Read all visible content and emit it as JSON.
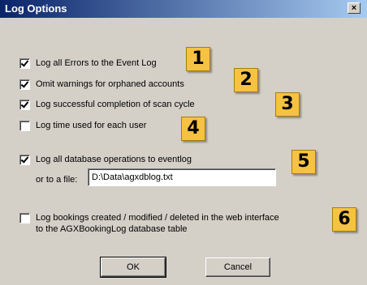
{
  "window": {
    "title": "Log Options",
    "close_label": "×"
  },
  "options": [
    {
      "label": "Log all Errors to the Event Log",
      "checked": true
    },
    {
      "label": "Omit warnings for orphaned accounts",
      "checked": true
    },
    {
      "label": "Log successful completion of scan cycle",
      "checked": true
    },
    {
      "label": "Log time used for each user",
      "checked": false
    },
    {
      "label": "Log all database operations to eventlog",
      "checked": true
    },
    {
      "label": "Log bookings created / modified / deleted in the web interface",
      "label2": "to the AGXBookingLog database table",
      "checked": false
    }
  ],
  "file": {
    "label": "or to a file:",
    "value": "D:\\Data\\agxdblog.txt"
  },
  "badges": [
    "1",
    "2",
    "3",
    "4",
    "5",
    "6"
  ],
  "buttons": {
    "ok": "OK",
    "cancel": "Cancel"
  },
  "colors": {
    "title_start": "#0a246a",
    "title_end": "#a6caf0",
    "badge": "#f5c242",
    "face": "#d4d0c8"
  }
}
